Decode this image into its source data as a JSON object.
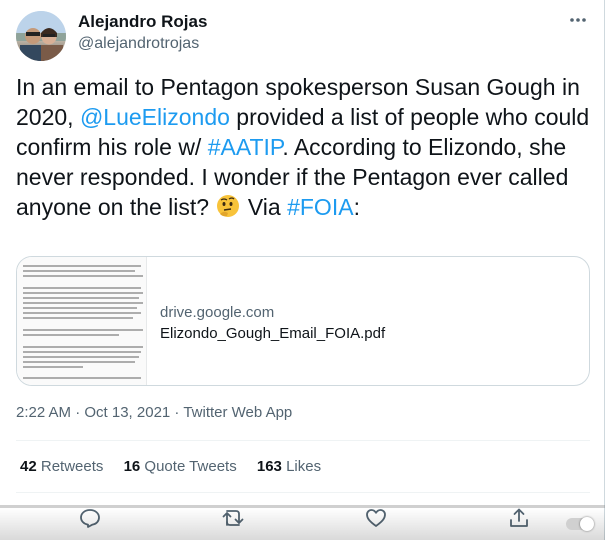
{
  "author": {
    "name": "Alejandro Rojas",
    "handle": "@alejandrotrojas"
  },
  "tweet": {
    "text_1": "In an email to Pentagon spokesperson Susan Gough in 2020, ",
    "mention": "@LueElizondo",
    "text_2": " provided a list of people who could confirm his role w/ ",
    "hashtag_1": "#AATIP",
    "text_3": ". According to Elizondo, she never responded. I wonder if the Pentagon ever called anyone on the list? ",
    "emoji": "🤔",
    "text_4": " Via ",
    "hashtag_2": "#FOIA",
    "text_5": ":"
  },
  "link_card": {
    "domain": "drive.google.com",
    "title": "Elizondo_Gough_Email_FOIA.pdf"
  },
  "meta": {
    "timestamp": "2:22 AM · Oct 13, 2021 · Twitter Web App"
  },
  "stats": {
    "retweets_count": "42",
    "retweets_label": "Retweets",
    "quotes_count": "16",
    "quotes_label": "Quote Tweets",
    "likes_count": "163",
    "likes_label": "Likes"
  },
  "icons": {
    "more": "more-horizontal-icon",
    "reply": "reply-icon",
    "retweet": "retweet-icon",
    "like": "heart-icon",
    "share": "share-icon"
  },
  "colors": {
    "accent": "#1d9bf0",
    "secondary_text": "#536471",
    "primary_text": "#0f1419"
  }
}
